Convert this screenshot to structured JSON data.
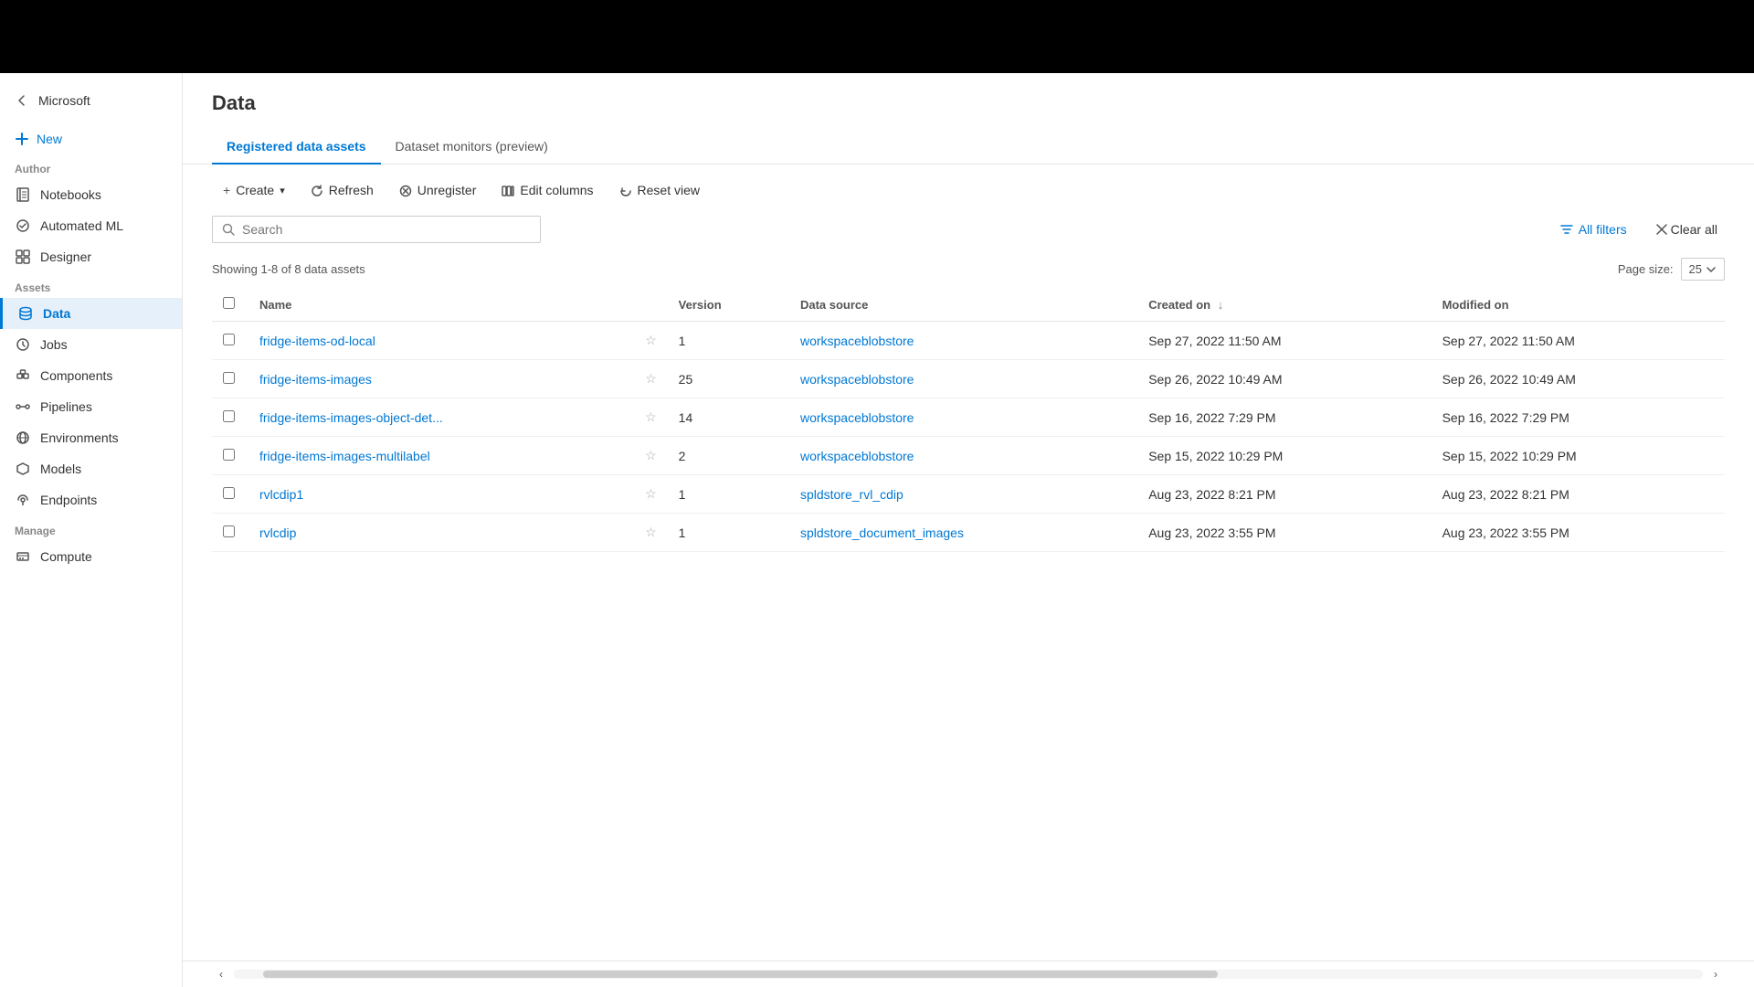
{
  "page": {
    "title": "Data",
    "background": "dark"
  },
  "sidebar": {
    "logo_label": "Microsoft",
    "new_label": "New",
    "sections": [
      {
        "label": "Author",
        "items": [
          {
            "id": "notebooks",
            "label": "Notebooks",
            "icon": "notebook"
          },
          {
            "id": "automated-ml",
            "label": "Automated ML",
            "icon": "auto"
          },
          {
            "id": "designer",
            "label": "Designer",
            "icon": "designer"
          }
        ]
      },
      {
        "label": "Assets",
        "items": [
          {
            "id": "data",
            "label": "Data",
            "icon": "data",
            "active": true
          },
          {
            "id": "jobs",
            "label": "Jobs",
            "icon": "jobs"
          },
          {
            "id": "components",
            "label": "Components",
            "icon": "components"
          },
          {
            "id": "pipelines",
            "label": "Pipelines",
            "icon": "pipelines"
          },
          {
            "id": "environments",
            "label": "Environments",
            "icon": "environments"
          },
          {
            "id": "models",
            "label": "Models",
            "icon": "models"
          },
          {
            "id": "endpoints",
            "label": "Endpoints",
            "icon": "endpoints"
          }
        ]
      },
      {
        "label": "Manage",
        "items": [
          {
            "id": "compute",
            "label": "Compute",
            "icon": "compute"
          }
        ]
      }
    ]
  },
  "tabs": [
    {
      "id": "registered",
      "label": "Registered data assets",
      "active": true
    },
    {
      "id": "monitors",
      "label": "Dataset monitors (preview)",
      "active": false
    }
  ],
  "toolbar": {
    "create_label": "Create",
    "refresh_label": "Refresh",
    "unregister_label": "Unregister",
    "edit_columns_label": "Edit columns",
    "reset_view_label": "Reset view"
  },
  "search": {
    "placeholder": "Search"
  },
  "filters": {
    "all_filters_label": "All filters",
    "clear_all_label": "Clear all"
  },
  "table": {
    "showing_text": "Showing 1-8 of 8 data assets",
    "page_size_label": "Page size:",
    "page_size_value": "25",
    "columns": [
      {
        "id": "name",
        "label": "Name",
        "sortable": false
      },
      {
        "id": "star",
        "label": "",
        "sortable": false
      },
      {
        "id": "version",
        "label": "Version",
        "sortable": false
      },
      {
        "id": "datasource",
        "label": "Data source",
        "sortable": false
      },
      {
        "id": "created_on",
        "label": "Created on",
        "sortable": true,
        "sort_dir": "desc"
      },
      {
        "id": "modified_on",
        "label": "Modified on",
        "sortable": false
      }
    ],
    "rows": [
      {
        "name": "fridge-items-od-local",
        "version": "1",
        "datasource": "workspaceblobstore",
        "created_on": "Sep 27, 2022 11:50 AM",
        "modified_on": "Sep 27, 2022 11:50 AM"
      },
      {
        "name": "fridge-items-images",
        "version": "25",
        "datasource": "workspaceblobstore",
        "created_on": "Sep 26, 2022 10:49 AM",
        "modified_on": "Sep 26, 2022 10:49 AM"
      },
      {
        "name": "fridge-items-images-object-det...",
        "version": "14",
        "datasource": "workspaceblobstore",
        "created_on": "Sep 16, 2022 7:29 PM",
        "modified_on": "Sep 16, 2022 7:29 PM"
      },
      {
        "name": "fridge-items-images-multilabel",
        "version": "2",
        "datasource": "workspaceblobstore",
        "created_on": "Sep 15, 2022 10:29 PM",
        "modified_on": "Sep 15, 2022 10:29 PM"
      },
      {
        "name": "rvlcdip1",
        "version": "1",
        "datasource": "spldstore_rvl_cdip",
        "created_on": "Aug 23, 2022 8:21 PM",
        "modified_on": "Aug 23, 2022 8:21 PM"
      },
      {
        "name": "rvlcdip",
        "version": "1",
        "datasource": "spldstore_document_images",
        "created_on": "Aug 23, 2022 3:55 PM",
        "modified_on": "Aug 23, 2022 3:55 PM"
      }
    ]
  }
}
